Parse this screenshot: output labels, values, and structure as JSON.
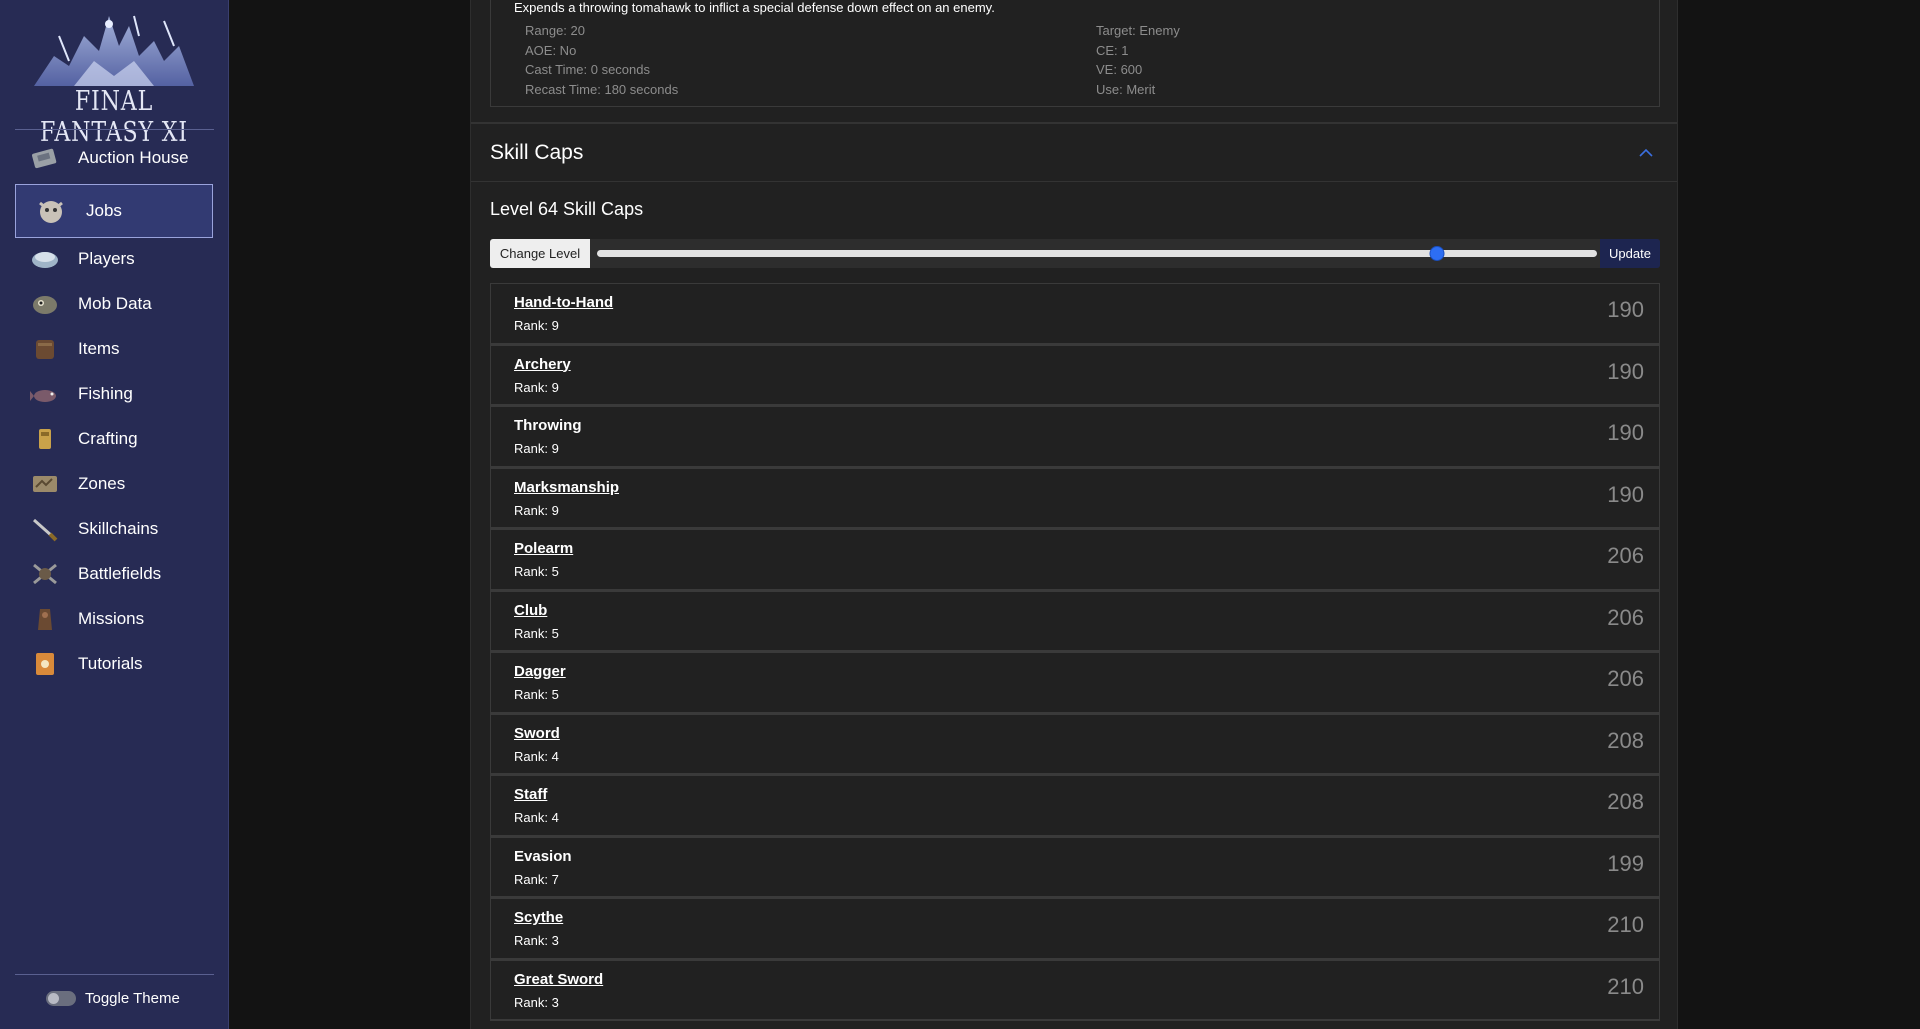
{
  "sidebar": {
    "logo_text": "FINAL FANTASY XI",
    "items": [
      {
        "label": "Auction House",
        "icon": "auction-house-icon"
      },
      {
        "label": "Jobs",
        "icon": "jobs-icon",
        "active": true
      },
      {
        "label": "Players",
        "icon": "players-icon"
      },
      {
        "label": "Mob Data",
        "icon": "mob-data-icon"
      },
      {
        "label": "Items",
        "icon": "items-icon"
      },
      {
        "label": "Fishing",
        "icon": "fishing-icon"
      },
      {
        "label": "Crafting",
        "icon": "crafting-icon"
      },
      {
        "label": "Zones",
        "icon": "zones-icon"
      },
      {
        "label": "Skillchains",
        "icon": "skillchains-icon"
      },
      {
        "label": "Battlefields",
        "icon": "battlefields-icon"
      },
      {
        "label": "Missions",
        "icon": "missions-icon"
      },
      {
        "label": "Tutorials",
        "icon": "tutorials-icon"
      }
    ],
    "toggle_theme_label": "Toggle Theme"
  },
  "ability": {
    "description": "Expends a throwing tomahawk to inflict a special defense down effect on an enemy.",
    "range": "Range: 20",
    "aoe": "AOE: No",
    "cast_time": "Cast Time: 0 seconds",
    "recast_time": "Recast Time: 180 seconds",
    "target": "Target: Enemy",
    "ce": "CE: 1",
    "ve": "VE: 600",
    "use": "Use: Merit"
  },
  "skill_caps": {
    "section_title": "Skill Caps",
    "level_title": "Level 64 Skill Caps",
    "change_level_label": "Change Level",
    "update_label": "Update",
    "level_fraction": 0.84,
    "skills": [
      {
        "name": "Hand-to-Hand",
        "rank": "Rank: 9",
        "value": "190",
        "link": true
      },
      {
        "name": "Archery",
        "rank": "Rank: 9",
        "value": "190",
        "link": true
      },
      {
        "name": "Throwing",
        "rank": "Rank: 9",
        "value": "190",
        "link": false
      },
      {
        "name": "Marksmanship",
        "rank": "Rank: 9",
        "value": "190",
        "link": true
      },
      {
        "name": "Polearm",
        "rank": "Rank: 5",
        "value": "206",
        "link": true
      },
      {
        "name": "Club",
        "rank": "Rank: 5",
        "value": "206",
        "link": true
      },
      {
        "name": "Dagger",
        "rank": "Rank: 5",
        "value": "206",
        "link": true
      },
      {
        "name": "Sword",
        "rank": "Rank: 4",
        "value": "208",
        "link": true
      },
      {
        "name": "Staff",
        "rank": "Rank: 4",
        "value": "208",
        "link": true
      },
      {
        "name": "Evasion",
        "rank": "Rank: 7",
        "value": "199",
        "link": false
      },
      {
        "name": "Scythe",
        "rank": "Rank: 3",
        "value": "210",
        "link": true
      },
      {
        "name": "Great Sword",
        "rank": "Rank: 3",
        "value": "210",
        "link": true
      }
    ]
  }
}
